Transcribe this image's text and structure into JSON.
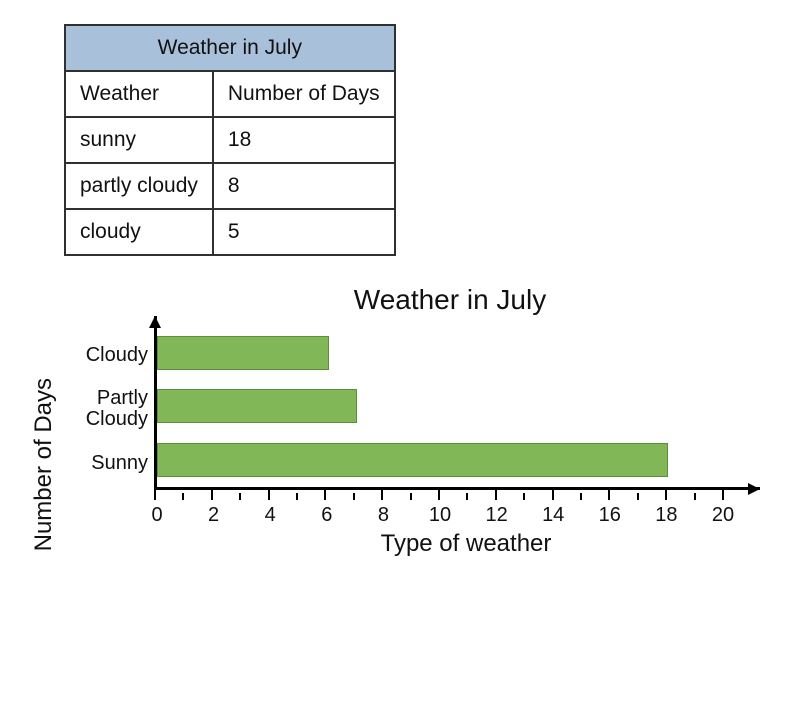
{
  "table": {
    "title": "Weather in July",
    "col1": "Weather",
    "col2": "Number of Days",
    "rows": [
      {
        "weather": "sunny",
        "days": "18"
      },
      {
        "weather": "partly cloudy",
        "days": "8"
      },
      {
        "weather": "cloudy",
        "days": "5"
      }
    ]
  },
  "chart_data": {
    "type": "bar",
    "orientation": "horizontal",
    "title": "Weather in July",
    "xlabel": "Type of weather",
    "ylabel": "Number of Days",
    "xlim": [
      0,
      20
    ],
    "xticks_major": [
      0,
      2,
      4,
      6,
      8,
      10,
      12,
      14,
      16,
      18,
      20
    ],
    "categories": [
      "Cloudy",
      "Partly Cloudy",
      "Sunny"
    ],
    "values": [
      6,
      7,
      18
    ],
    "bar_color": "#82b758"
  },
  "cat_labels": {
    "0": "Cloudy",
    "1": "Partly\nCloudy",
    "2": "Sunny"
  }
}
